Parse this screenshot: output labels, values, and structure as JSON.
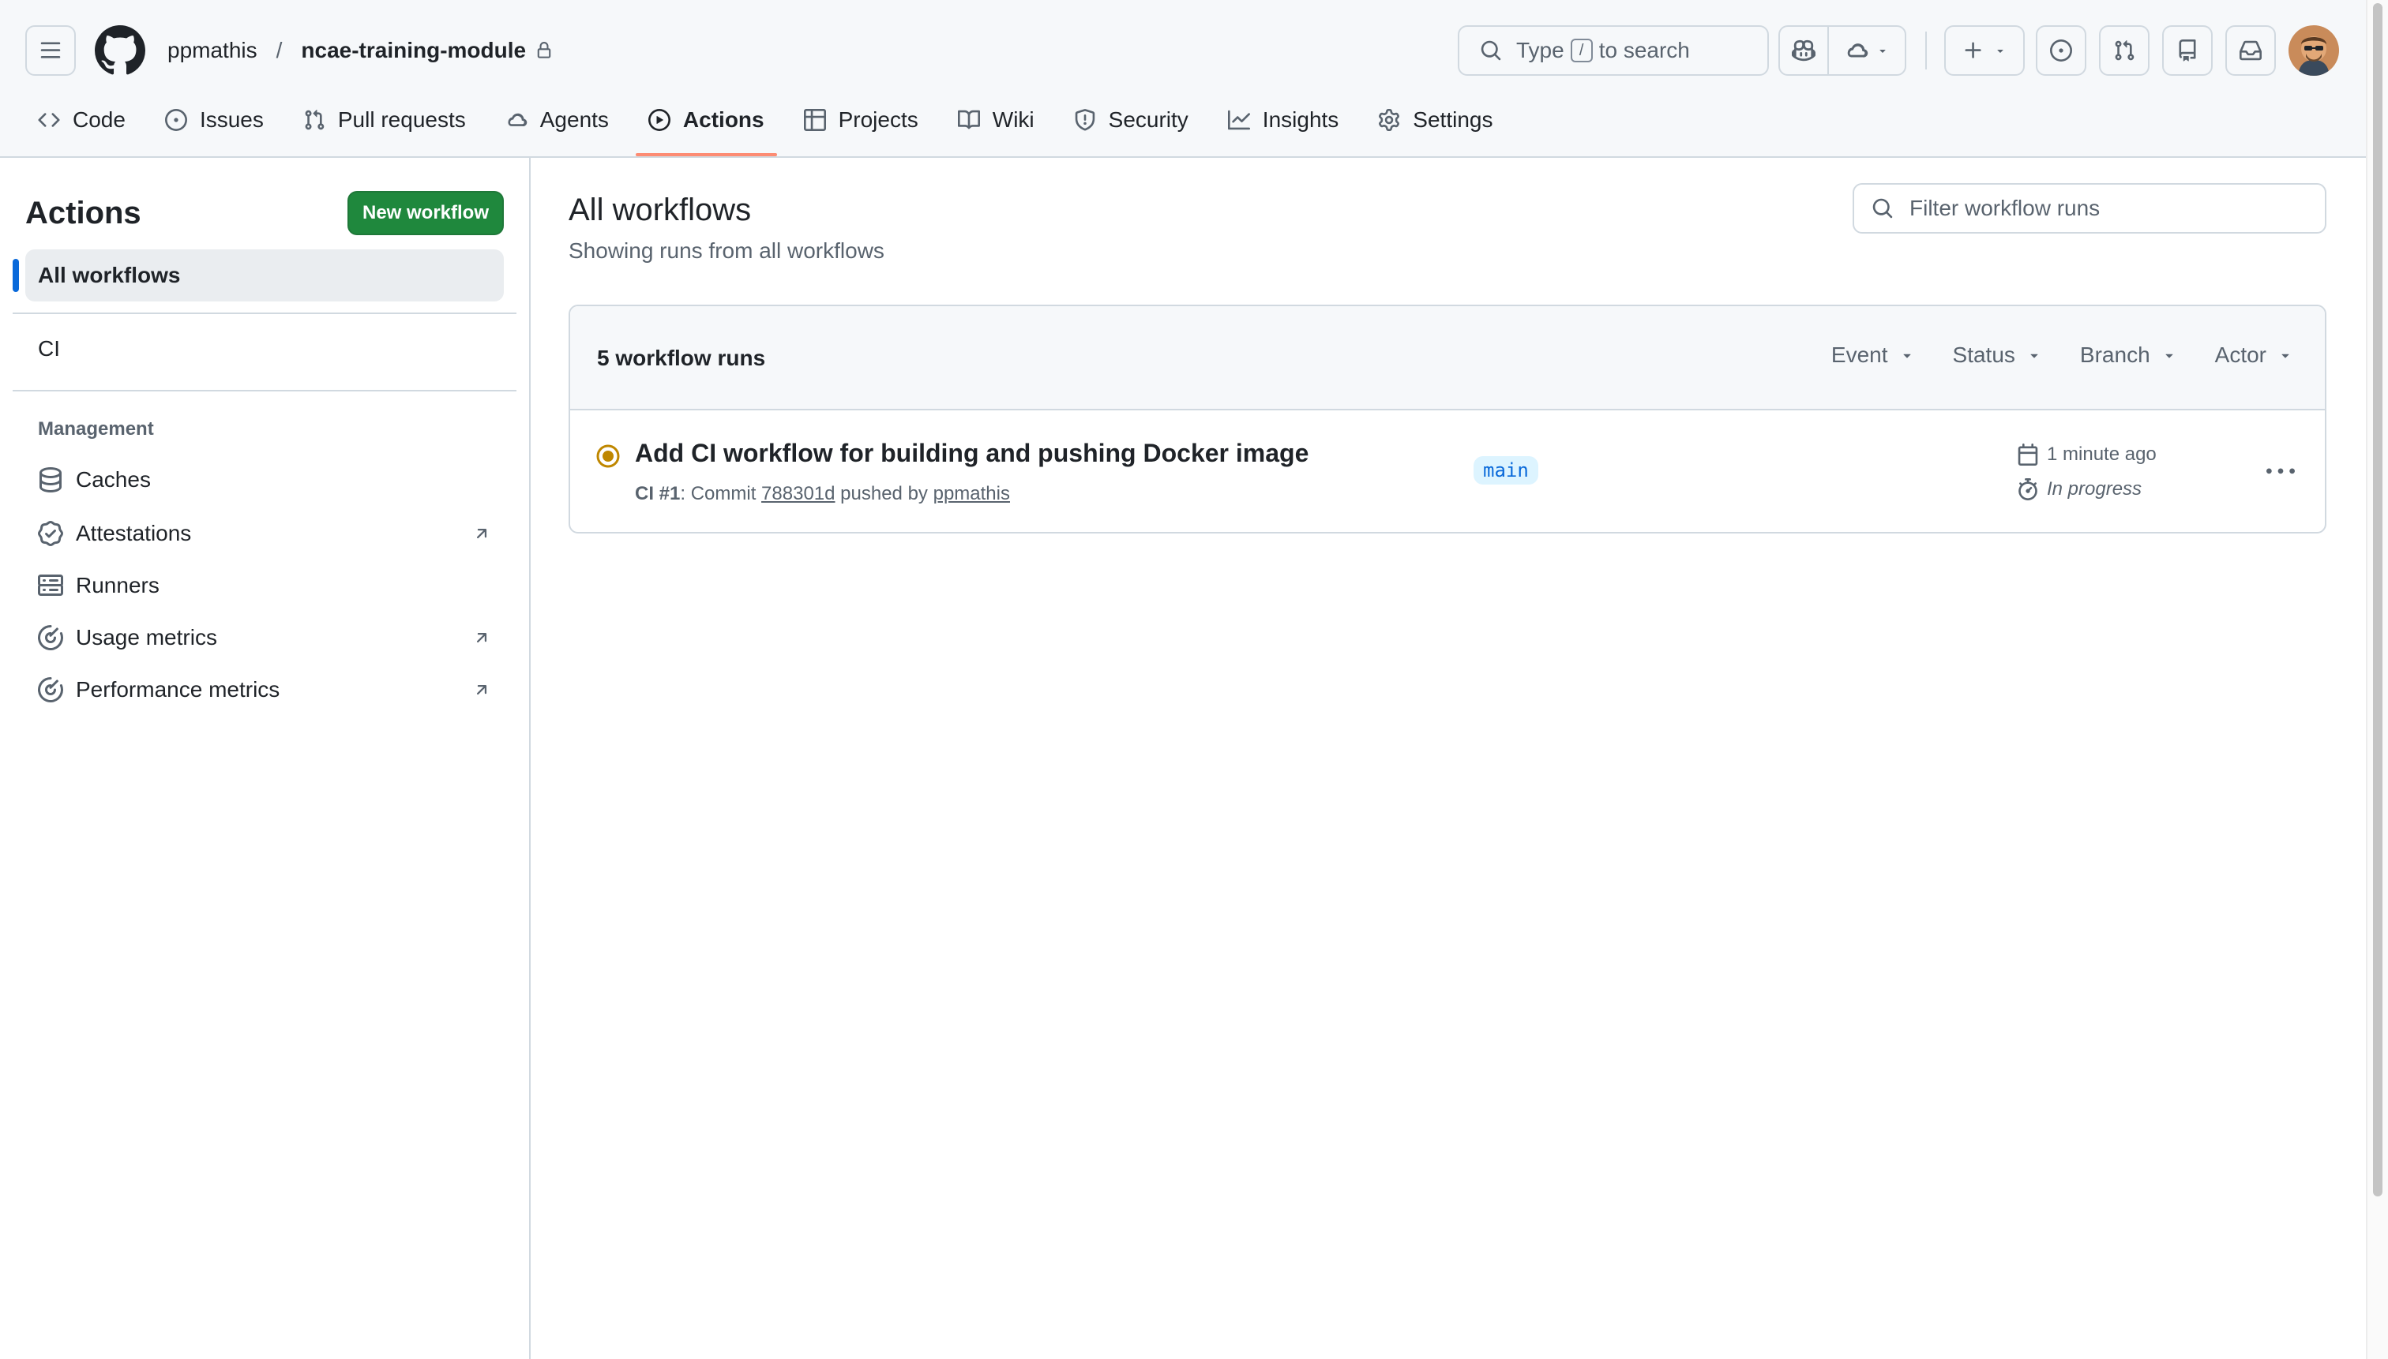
{
  "header": {
    "owner": "ppmathis",
    "separator": "/",
    "repo": "ncae-training-module",
    "search": {
      "prefix": "Type",
      "key": "/",
      "suffix": "to search"
    }
  },
  "nav": {
    "code": "Code",
    "issues": "Issues",
    "pull_requests": "Pull requests",
    "agents": "Agents",
    "actions": "Actions",
    "projects": "Projects",
    "wiki": "Wiki",
    "security": "Security",
    "insights": "Insights",
    "settings": "Settings"
  },
  "sidebar": {
    "title": "Actions",
    "new_workflow": "New workflow",
    "all_workflows": "All workflows",
    "workflows": [
      "CI"
    ],
    "management_heading": "Management",
    "management": [
      {
        "label": "Caches",
        "icon": "database-icon",
        "external": false
      },
      {
        "label": "Attestations",
        "icon": "verified-icon",
        "external": true
      },
      {
        "label": "Runners",
        "icon": "server-icon",
        "external": false
      },
      {
        "label": "Usage metrics",
        "icon": "meter-icon",
        "external": true
      },
      {
        "label": "Performance metrics",
        "icon": "meter-icon",
        "external": true
      }
    ]
  },
  "main": {
    "title": "All workflows",
    "subtitle": "Showing runs from all workflows",
    "filter_placeholder": "Filter workflow runs",
    "runs_count": "5 workflow runs",
    "filters": {
      "event": "Event",
      "status": "Status",
      "branch": "Branch",
      "actor": "Actor"
    },
    "run": {
      "title": "Add CI workflow for building and pushing Docker image",
      "workflow": "CI #1",
      "commit_label": ": Commit",
      "commit": "788301d",
      "pushed_by": "pushed by",
      "actor": "ppmathis",
      "branch": "main",
      "time": "1 minute ago",
      "duration": "In progress",
      "status_color": "#bf8700"
    }
  },
  "colors": {
    "accent": "#0969da",
    "primary_button": "#1f883d",
    "selected_tab_underline": "#fd8c73",
    "in_progress": "#bf8700"
  }
}
